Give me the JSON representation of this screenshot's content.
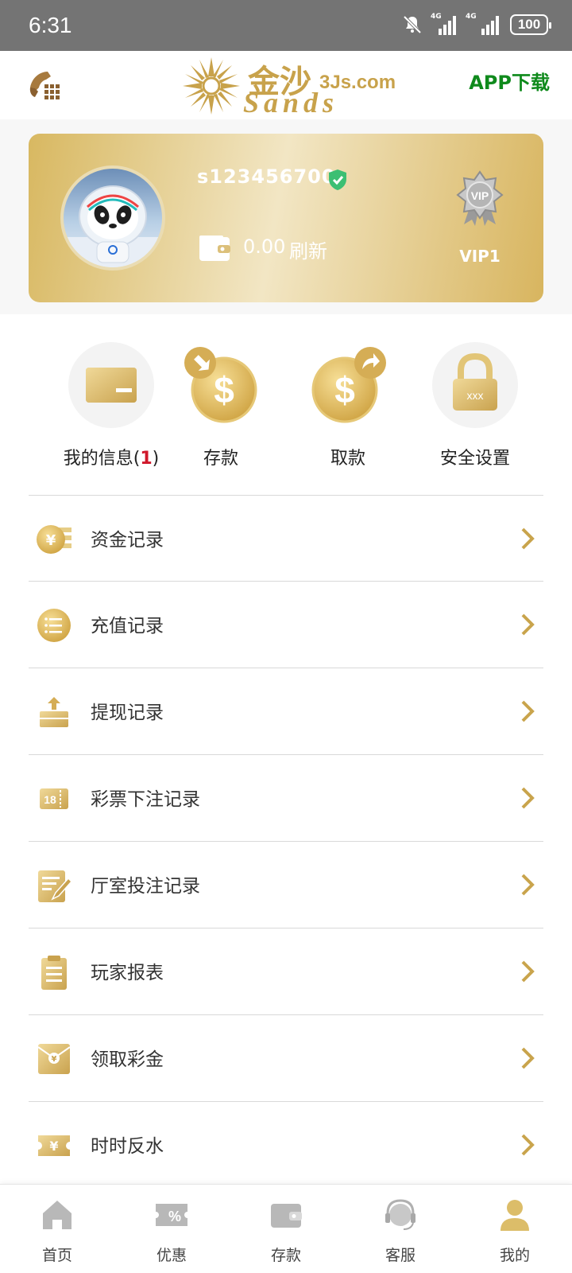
{
  "status_bar": {
    "time": "6:31",
    "battery": "100",
    "network_label": "4G"
  },
  "header": {
    "logo_cn": "金沙",
    "logo_com": "3Js.com",
    "logo_en": "Sands",
    "app_download": "APP下载"
  },
  "profile": {
    "username": "s123456700",
    "balance": "0.00",
    "refresh": "刷新",
    "vip_level": "VIP1",
    "vip_badge_text": "VIP"
  },
  "actions": [
    {
      "label": "我的信息(",
      "count": "1",
      "suffix": ")",
      "icon": "card-icon"
    },
    {
      "label": "存款",
      "icon": "deposit-dollar-icon"
    },
    {
      "label": "取款",
      "icon": "withdraw-dollar-icon"
    },
    {
      "label": "安全设置",
      "icon": "lock-icon",
      "lock_text": "xxx"
    }
  ],
  "menu": [
    {
      "label": "资金记录",
      "icon": "yen-coin-icon"
    },
    {
      "label": "充值记录",
      "icon": "list-coin-icon"
    },
    {
      "label": "提现记录",
      "icon": "withdraw-box-icon"
    },
    {
      "label": "彩票下注记录",
      "icon": "lottery-ticket-icon",
      "icon_text": "18"
    },
    {
      "label": "厅室投注记录",
      "icon": "notepad-pen-icon"
    },
    {
      "label": "玩家报表",
      "icon": "clipboard-icon"
    },
    {
      "label": "领取彩金",
      "icon": "red-envelope-icon"
    },
    {
      "label": "时时反水",
      "icon": "yen-ticket-icon"
    }
  ],
  "tabs": [
    {
      "label": "首页",
      "icon": "home-icon"
    },
    {
      "label": "优惠",
      "icon": "coupon-icon"
    },
    {
      "label": "存款",
      "icon": "wallet-icon"
    },
    {
      "label": "客服",
      "icon": "headset-icon"
    },
    {
      "label": "我的",
      "icon": "user-icon"
    }
  ],
  "colors": {
    "gold": "#d4b05a",
    "gold_light": "#f2e6c4",
    "green": "#0f8a1c",
    "badge_red": "#d0182b",
    "status_bar": "#747474"
  }
}
